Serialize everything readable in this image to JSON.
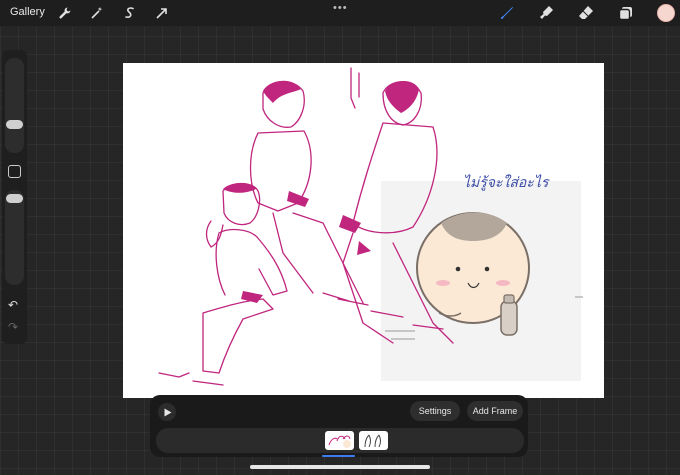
{
  "topbar": {
    "gallery_label": "Gallery",
    "left_tools": [
      "wrench-icon",
      "magic-wand-icon",
      "selection-icon",
      "transform-arrow-icon"
    ],
    "right_tools": [
      "brush-icon",
      "smudge-icon",
      "eraser-icon",
      "layers-icon"
    ],
    "active_tool": "brush-icon",
    "more_label": "•••",
    "current_color": "#f6d7d0"
  },
  "sidebar": {
    "size_slider_level": 0.3,
    "opacity_slider_level": 0.55,
    "undo_icon": "undo-icon",
    "redo_icon": "redo-icon"
  },
  "canvas": {
    "handwritten_text": "ไม่รู้จะใส่อะไร",
    "ink_color": "#c0267e"
  },
  "animation": {
    "play_icon": "play-icon",
    "settings_label": "Settings",
    "add_frame_label": "Add Frame",
    "frames": [
      "frame-1",
      "frame-2"
    ],
    "selected_frame": 1
  }
}
